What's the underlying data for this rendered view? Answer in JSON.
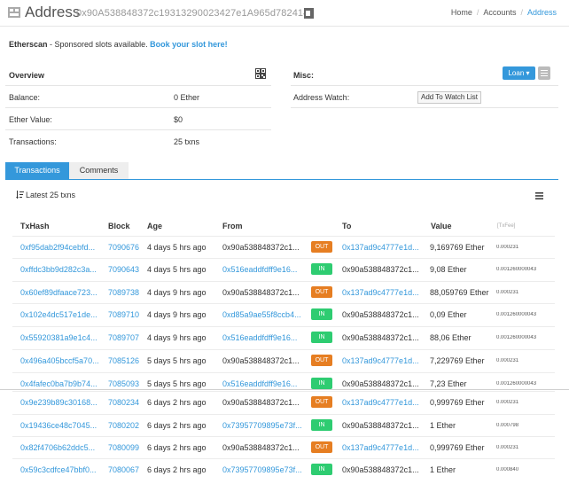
{
  "header": {
    "title": "Address",
    "address": "0x90A538848372c19313290023427e1A965d782414",
    "breadcrumb": [
      "Home",
      "Accounts",
      "Address"
    ]
  },
  "sponsor": {
    "brand": "Etherscan",
    "text": " - Sponsored slots available. ",
    "link": "Book your slot here!"
  },
  "overview": {
    "title": "Overview",
    "rows": [
      {
        "label": "Balance:",
        "value": "0 Ether"
      },
      {
        "label": "Ether Value:",
        "value": "$0"
      },
      {
        "label": "Transactions:",
        "value": "25 txns"
      }
    ]
  },
  "misc": {
    "title": "Misc:",
    "loan_label": "Loan ▾",
    "watch_label": "Address Watch:",
    "watch_button": "Add To Watch List"
  },
  "tabs": [
    "Transactions",
    "Comments"
  ],
  "latest_label": "Latest 25 txns",
  "table": {
    "headers": [
      "TxHash",
      "Block",
      "Age",
      "From",
      "To",
      "Value",
      "[TxFee]"
    ],
    "rows": [
      {
        "hash": "0xf95dab2f94cebfd...",
        "block": "7090676",
        "age": "4 days 5 hrs ago",
        "from": "0x90a538848372c1...",
        "from_link": false,
        "dir": "OUT",
        "to": "0x137ad9c4777e1d...",
        "to_link": true,
        "value": "9,169769 Ether",
        "fee": "0.000231"
      },
      {
        "hash": "0xffdc3bb9d282c3a...",
        "block": "7090643",
        "age": "4 days 5 hrs ago",
        "from": "0x516eaddfdff9e16...",
        "from_link": true,
        "dir": "IN",
        "to": "0x90a538848372c1...",
        "to_link": false,
        "value": "9,08 Ether",
        "fee": "0.001260000043"
      },
      {
        "hash": "0x60ef89dfaace723...",
        "block": "7089738",
        "age": "4 days 9 hrs ago",
        "from": "0x90a538848372c1...",
        "from_link": false,
        "dir": "OUT",
        "to": "0x137ad9c4777e1d...",
        "to_link": true,
        "value": "88,059769 Ether",
        "fee": "0.000231"
      },
      {
        "hash": "0x102e4dc517e1de...",
        "block": "7089710",
        "age": "4 days 9 hrs ago",
        "from": "0xd85a9ae55f8ccb4...",
        "from_link": true,
        "dir": "IN",
        "to": "0x90a538848372c1...",
        "to_link": false,
        "value": "0,09 Ether",
        "fee": "0.001260000043"
      },
      {
        "hash": "0x55920381a9e1c4...",
        "block": "7089707",
        "age": "4 days 9 hrs ago",
        "from": "0x516eaddfdff9e16...",
        "from_link": true,
        "dir": "IN",
        "to": "0x90a538848372c1...",
        "to_link": false,
        "value": "88,06 Ether",
        "fee": "0.001260000043"
      },
      {
        "hash": "0x496a405bccf5a70...",
        "block": "7085126",
        "age": "5 days 5 hrs ago",
        "from": "0x90a538848372c1...",
        "from_link": false,
        "dir": "OUT",
        "to": "0x137ad9c4777e1d...",
        "to_link": true,
        "value": "7,229769 Ether",
        "fee": "0.000231"
      },
      {
        "hash": "0x4fafec0ba7b9b74...",
        "block": "7085093",
        "age": "5 days 5 hrs ago",
        "from": "0x516eaddfdff9e16...",
        "from_link": true,
        "dir": "IN",
        "to": "0x90a538848372c1...",
        "to_link": false,
        "value": "7,23 Ether",
        "fee": "0.001260000043"
      },
      {
        "hash": "0x9e239b89c30168...",
        "block": "7080234",
        "age": "6 days 2 hrs ago",
        "from": "0x90a538848372c1...",
        "from_link": false,
        "dir": "OUT",
        "to": "0x137ad9c4777e1d...",
        "to_link": true,
        "value": "0,999769 Ether",
        "fee": "0.000231"
      },
      {
        "hash": "0x19436ce48c7045...",
        "block": "7080202",
        "age": "6 days 2 hrs ago",
        "from": "0x73957709895e73f...",
        "from_link": true,
        "dir": "IN",
        "to": "0x90a538848372c1...",
        "to_link": false,
        "value": "1 Ether",
        "fee": "0.000798"
      },
      {
        "hash": "0x82f4706b62ddc5...",
        "block": "7080099",
        "age": "6 days 2 hrs ago",
        "from": "0x90a538848372c1...",
        "from_link": false,
        "dir": "OUT",
        "to": "0x137ad9c4777e1d...",
        "to_link": true,
        "value": "0,999769 Ether",
        "fee": "0.000231"
      },
      {
        "hash": "0x59c3cdfce47bbf0...",
        "block": "7080067",
        "age": "6 days 2 hrs ago",
        "from": "0x73957709895e73f...",
        "from_link": true,
        "dir": "IN",
        "to": "0x90a538848372c1...",
        "to_link": false,
        "value": "1 Ether",
        "fee": "0.000840"
      }
    ]
  },
  "colors": {
    "link": "#3498db",
    "out": "#e67e22",
    "in": "#2ecc71"
  },
  "icons": [
    "logo-icon",
    "copy-icon",
    "qr-code-icon",
    "menu-icon",
    "sort-icon",
    "list-icon"
  ]
}
